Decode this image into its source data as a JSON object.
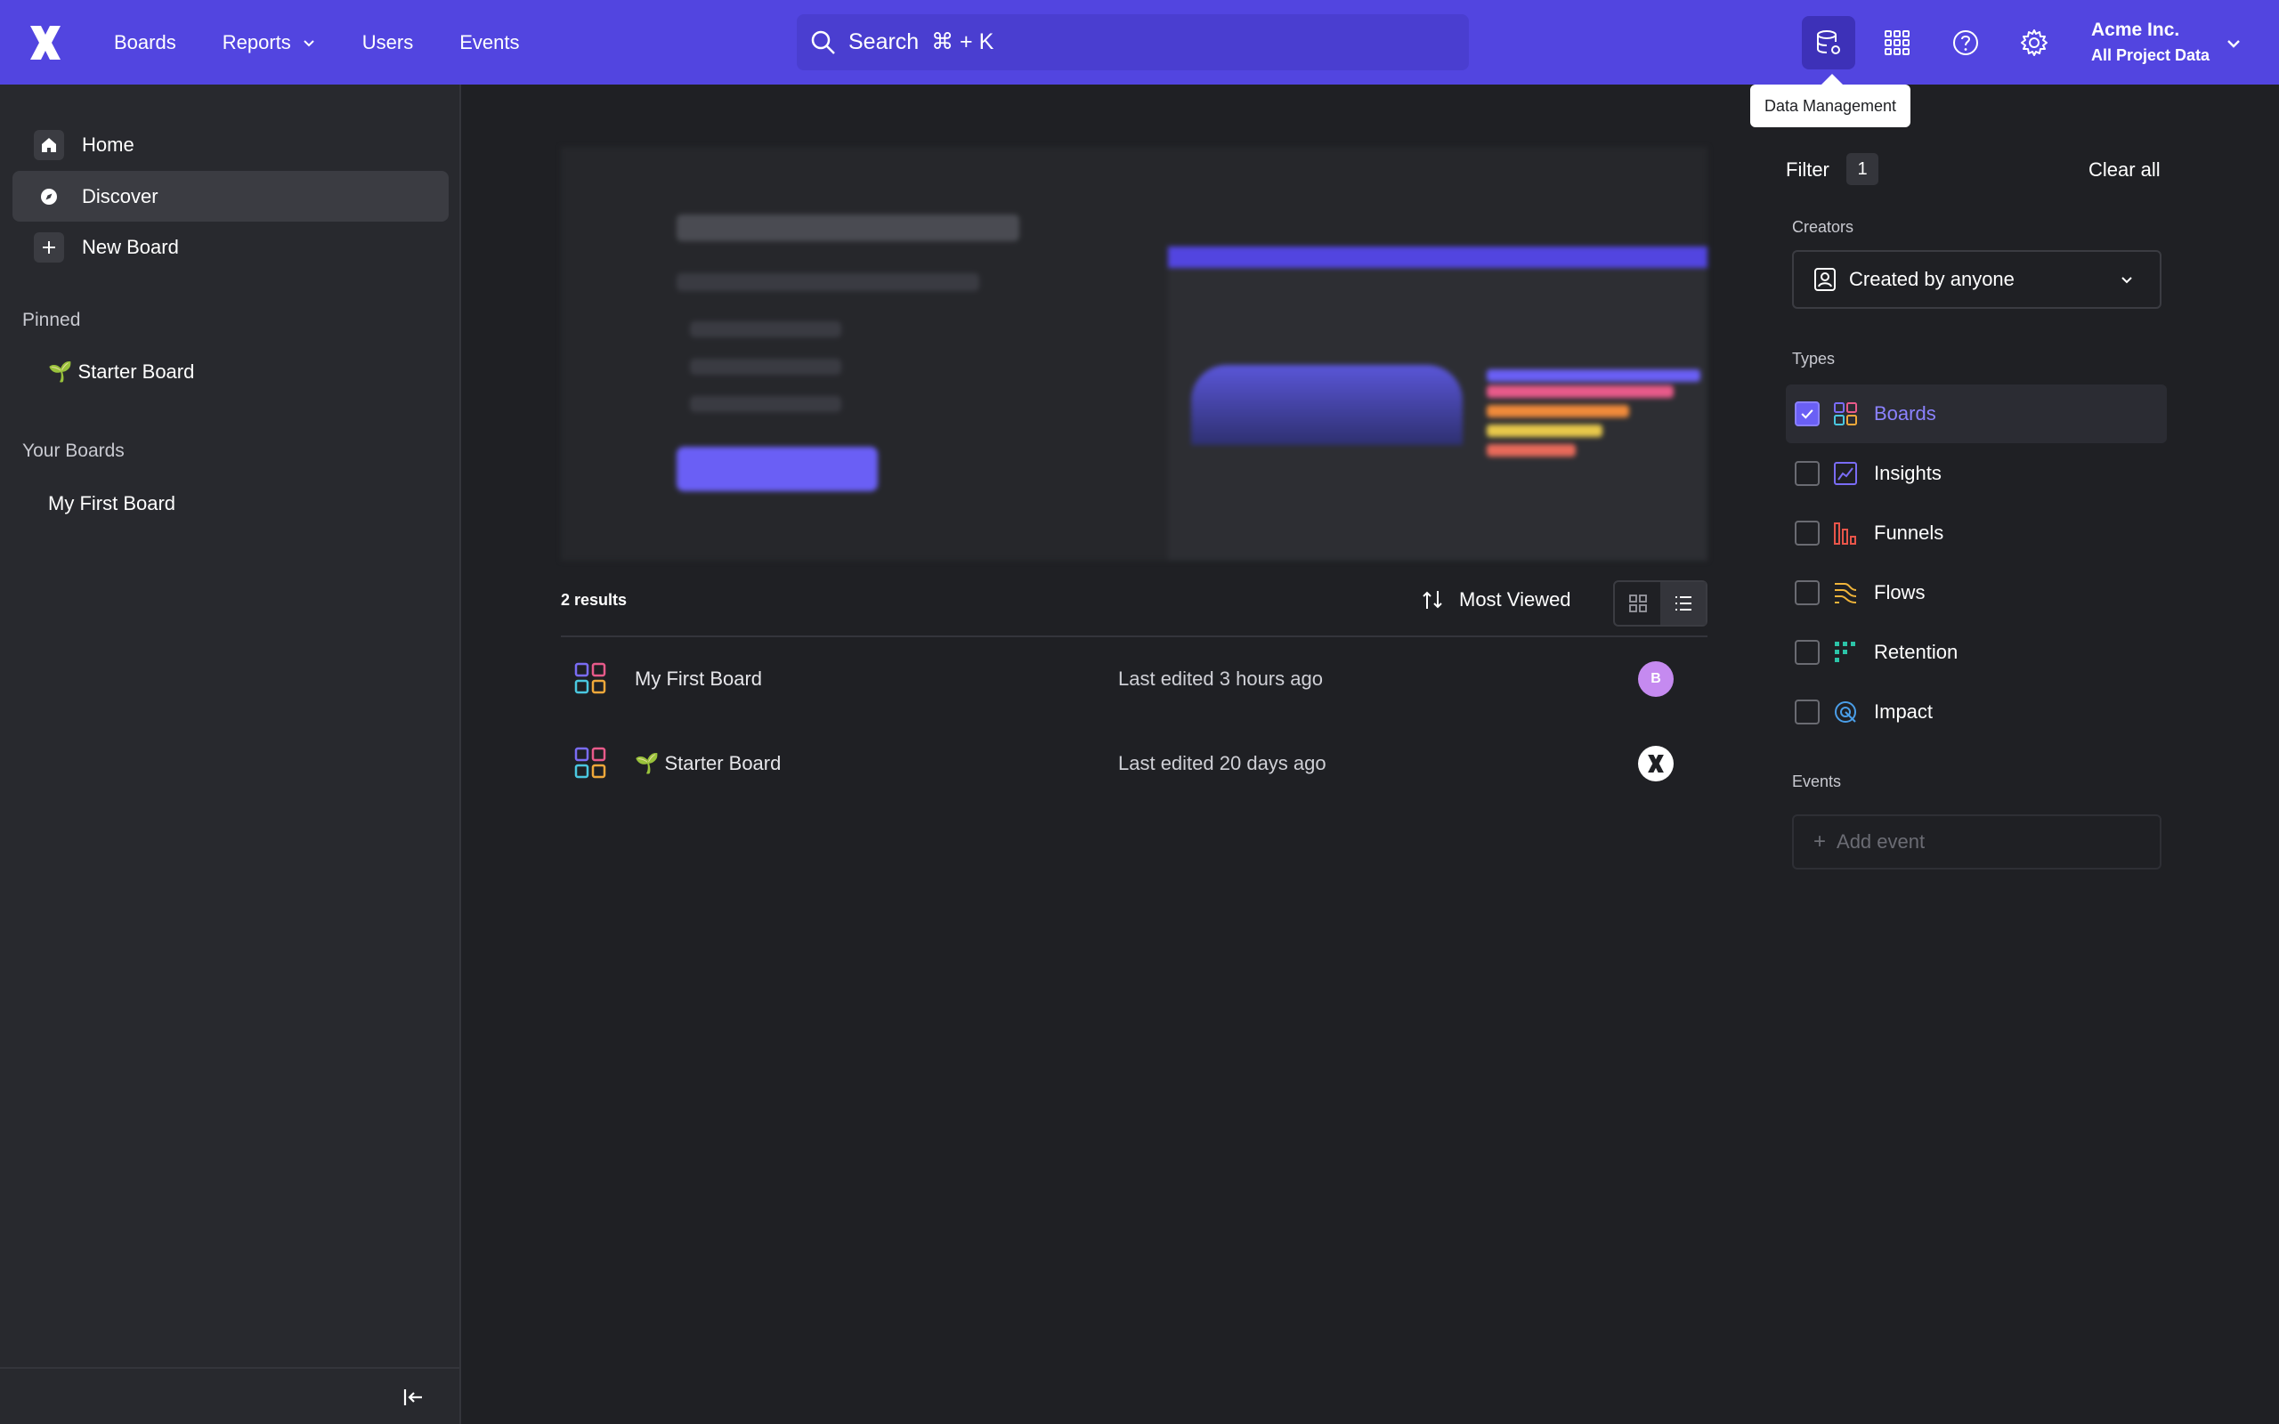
{
  "topbar": {
    "nav": [
      "Boards",
      "Reports",
      "Users",
      "Events"
    ],
    "search_placeholder": "Search  ⌘ + K",
    "account_name": "Acme Inc.",
    "account_project": "All Project Data",
    "tooltip": "Data Management",
    "brand_color": "#5245e0"
  },
  "sidebar": {
    "items": [
      {
        "label": "Home",
        "icon": "home-icon"
      },
      {
        "label": "Discover",
        "icon": "compass-icon"
      },
      {
        "label": "New Board",
        "icon": "plus-icon"
      }
    ],
    "pinned_heading": "Pinned",
    "pinned": [
      "🌱 Starter Board"
    ],
    "your_boards_heading": "Your Boards",
    "your_boards": [
      "My First Board"
    ]
  },
  "main": {
    "results_count": "2 results",
    "sort_label": "Most Viewed",
    "view_mode": "list",
    "boards": [
      {
        "name": "My First Board",
        "edited": "Last edited 3 hours ago",
        "avatar": "B",
        "avatar_color": "#c58af0"
      },
      {
        "name": "🌱 Starter Board",
        "edited": "Last edited 20 days ago",
        "avatar": "",
        "avatar_color": "#ffffff"
      }
    ]
  },
  "filter": {
    "title": "Filter",
    "count": "1",
    "clear_label": "Clear all",
    "creators_heading": "Creators",
    "creator_value": "Created by anyone",
    "types_heading": "Types",
    "types": [
      {
        "label": "Boards",
        "checked": true,
        "icon": "boards-icon"
      },
      {
        "label": "Insights",
        "checked": false,
        "icon": "insights-icon"
      },
      {
        "label": "Funnels",
        "checked": false,
        "icon": "funnels-icon"
      },
      {
        "label": "Flows",
        "checked": false,
        "icon": "flows-icon"
      },
      {
        "label": "Retention",
        "checked": false,
        "icon": "retention-icon"
      },
      {
        "label": "Impact",
        "checked": false,
        "icon": "impact-icon"
      }
    ],
    "events_heading": "Events",
    "add_event_label": "Add event",
    "accent_color": "#6a5ff5"
  }
}
